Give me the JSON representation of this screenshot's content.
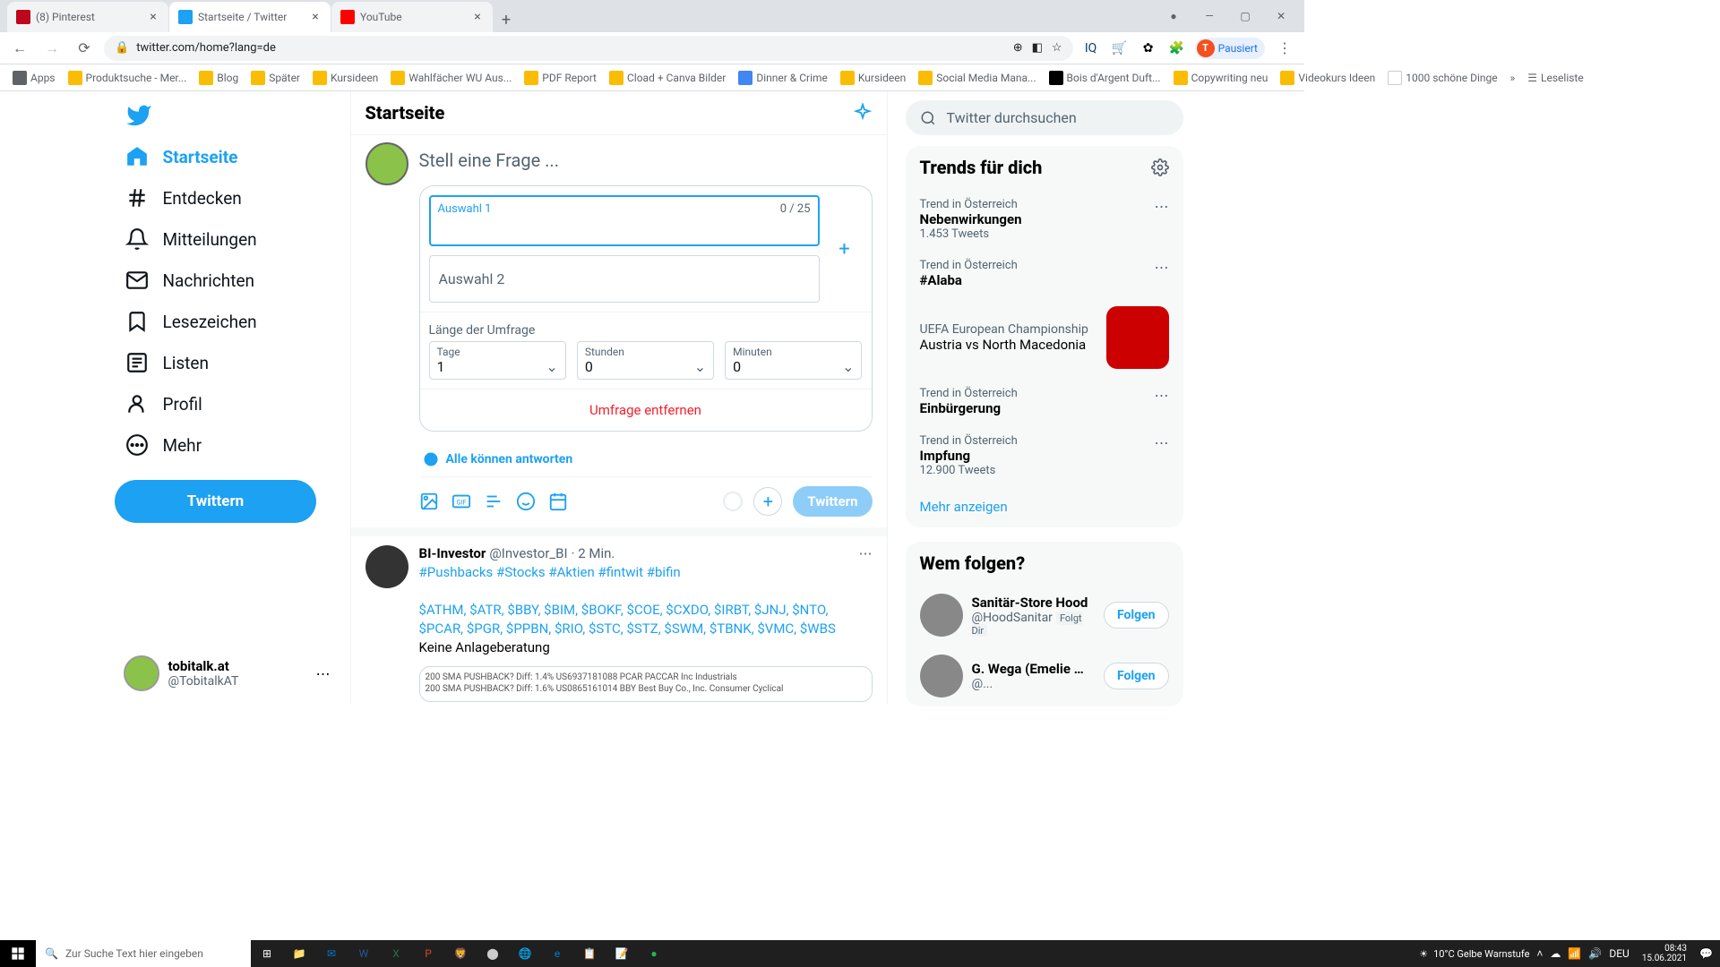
{
  "browser": {
    "tabs": [
      {
        "title": "(8) Pinterest",
        "favicon": "#bd081c"
      },
      {
        "title": "Startseite / Twitter",
        "favicon": "#1da1f2",
        "active": true
      },
      {
        "title": "YouTube",
        "favicon": "#ff0000"
      }
    ],
    "url": "twitter.com/home?lang=de",
    "profile_status": "Pausiert",
    "bookmarks": [
      "Apps",
      "Produktsuche - Mer...",
      "Blog",
      "Später",
      "Kursideen",
      "Wahlfächer WU Aus...",
      "PDF Report",
      "Cload + Canva Bilder",
      "Dinner & Crime",
      "Kursideen",
      "Social Media Mana...",
      "Bois d'Argent Duft...",
      "Copywriting neu",
      "Videokurs Ideen",
      "1000 schöne Dinge"
    ],
    "reading_list": "Leseliste"
  },
  "nav": {
    "home": "Startseite",
    "explore": "Entdecken",
    "notifications": "Mitteilungen",
    "messages": "Nachrichten",
    "bookmarks": "Lesezeichen",
    "lists": "Listen",
    "profile": "Profil",
    "more": "Mehr",
    "tweet_btn": "Twittern"
  },
  "account": {
    "name": "tobitalk.at",
    "handle": "@TobitalkAT"
  },
  "header": {
    "title": "Startseite"
  },
  "compose": {
    "placeholder": "Stell eine Frage ...",
    "poll": {
      "option1_label": "Auswahl 1",
      "option1_counter": "0 / 25",
      "option2_placeholder": "Auswahl 2",
      "duration_label": "Länge der Umfrage",
      "days_label": "Tage",
      "days_value": "1",
      "hours_label": "Stunden",
      "hours_value": "0",
      "minutes_label": "Minuten",
      "minutes_value": "0",
      "remove": "Umfrage entfernen"
    },
    "reply_perm": "Alle können antworten",
    "submit": "Twittern"
  },
  "feed": {
    "tweet1": {
      "name": "BI-Investor",
      "handle": "@Investor_BI",
      "time": "· 2 Min.",
      "hashtags": "#Pushbacks #Stocks #Aktien #fintwit #bifin",
      "tickers": "$ATHM, $ATR, $BBY, $BIM, $BOKF, $COE, $CXDO, $IRBT, $JNJ, $NTO, $PCAR, $PGR, $PPBN, $RIO, $STC, $STZ, $SWM, $TBNK, $VMC, $WBS",
      "disclaimer": "Keine Anlageberatung",
      "img_row1": "200 SMA PUSHBACK? Diff: 1.4%   US6937181088   PCAR   PACCAR Inc                Industrials",
      "img_row2": "200 SMA PUSHBACK? Diff: 1.6%   US0865161014   BBY    Best Buy Co., Inc.        Consumer Cyclical"
    }
  },
  "search": {
    "placeholder": "Twitter durchsuchen"
  },
  "trends": {
    "title": "Trends für dich",
    "cat": "Trend in Österreich",
    "items": [
      {
        "name": "Nebenwirkungen",
        "count": "1.453 Tweets"
      },
      {
        "name": "#Alaba",
        "count": ""
      }
    ],
    "event": {
      "title": "UEFA European Championship",
      "sub": "Austria vs North Macedonia"
    },
    "items2": [
      {
        "name": "Einbürgerung",
        "count": ""
      },
      {
        "name": "Impfung",
        "count": "12.900 Tweets"
      }
    ],
    "show_more": "Mehr anzeigen"
  },
  "follow": {
    "title": "Wem folgen?",
    "items": [
      {
        "name": "Sanitär-Store Hood",
        "handle": "@HoodSanitar",
        "follows_you": "Folgt Dir"
      },
      {
        "name": "G. Wega (Emelie Whi...",
        "handle": "@..."
      }
    ],
    "follow_btn": "Folgen"
  },
  "taskbar": {
    "search": "Zur Suche Text hier eingeben",
    "weather": "10°C  Gelbe Warnstufe",
    "lang": "DEU",
    "time": "08:43",
    "date": "15.06.2021"
  }
}
